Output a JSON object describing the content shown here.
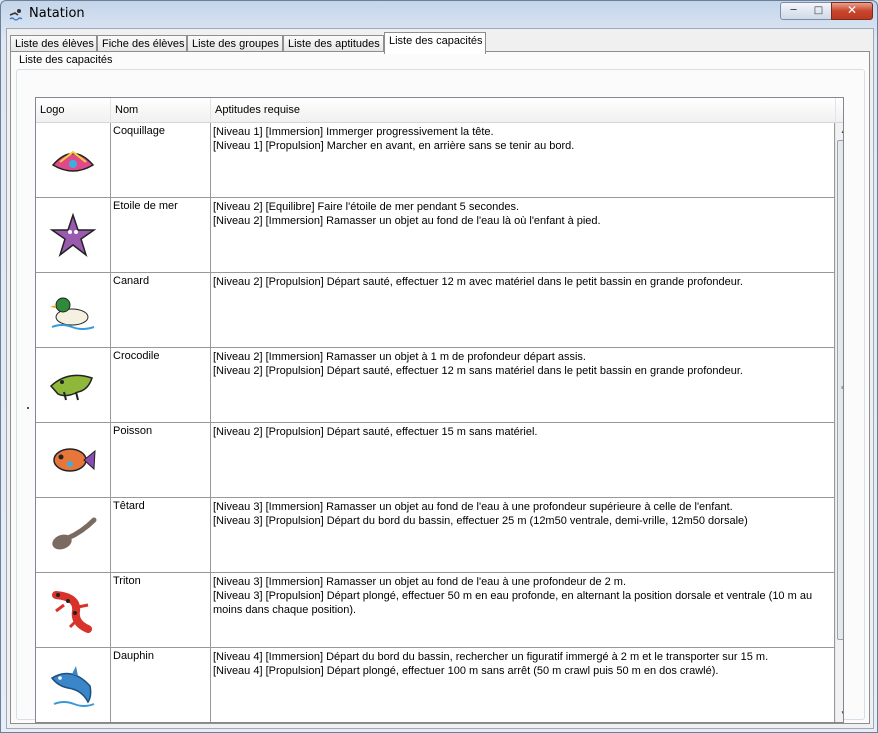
{
  "window": {
    "title": "Natation",
    "minimize": "─",
    "maximize": "□",
    "close": "✕"
  },
  "tabs": [
    {
      "label": "Liste des élèves",
      "active": false
    },
    {
      "label": "Fiche des élèves",
      "active": false
    },
    {
      "label": "Liste des groupes",
      "active": false
    },
    {
      "label": "Liste des aptitudes",
      "active": false
    },
    {
      "label": "Liste des capacités",
      "active": true
    }
  ],
  "group": {
    "label": "Liste des capacités"
  },
  "table": {
    "columns": {
      "logo": "Logo",
      "nom": "Nom",
      "aptitudes": "Aptitudes requise"
    },
    "rows": [
      {
        "nom": "Coquillage",
        "icon": "shell-icon",
        "color": "#e04a8a",
        "aptitudes": [
          "[Niveau 1] [Immersion] Immerger progressivement la tête.",
          "[Niveau 1] [Propulsion] Marcher en avant, en arrière sans se tenir au bord."
        ]
      },
      {
        "nom": "Etoile de mer",
        "icon": "starfish-icon",
        "color": "#9a5ab0",
        "aptitudes": [
          "[Niveau 2] [Equilibre] Faire l'étoile de mer pendant 5 secondes.",
          "[Niveau 2] [Immersion] Ramasser un objet au fond de l'eau là où l'enfant à pied."
        ]
      },
      {
        "nom": "Canard",
        "icon": "duck-icon",
        "color": "#2e8b3a",
        "aptitudes": [
          "[Niveau 2] [Propulsion] Départ sauté, effectuer 12 m avec matériel dans le petit bassin en grande profondeur."
        ]
      },
      {
        "nom": "Crocodile",
        "icon": "crocodile-icon",
        "color": "#8fb83a",
        "aptitudes": [
          "[Niveau 2] [Immersion] Ramasser un objet à 1 m de profondeur départ assis.",
          "[Niveau 2] [Propulsion] Départ sauté, effectuer 12 m sans matériel dans le petit bassin en grande profondeur."
        ]
      },
      {
        "nom": "Poisson",
        "icon": "fish-icon",
        "color": "#e8763a",
        "aptitudes": [
          "[Niveau 2] [Propulsion] Départ sauté, effectuer 15 m sans matériel."
        ]
      },
      {
        "nom": "Têtard",
        "icon": "tadpole-icon",
        "color": "#7a6a60",
        "aptitudes": [
          "[Niveau 3] [Immersion] Ramasser un objet au fond de l'eau à une profondeur supérieure à celle de l'enfant.",
          "[Niveau 3] [Propulsion] Départ du bord du bassin, effectuer 25 m (12m50 ventrale, demi-vrille, 12m50 dorsale)"
        ]
      },
      {
        "nom": "Triton",
        "icon": "newt-icon",
        "color": "#d8322a",
        "aptitudes": [
          "[Niveau 3] [Immersion] Ramasser un objet au fond de l'eau à une profondeur de 2 m.",
          "[Niveau 3] [Propulsion] Départ plongé, effectuer 50 m en eau profonde, en alternant la position dorsale et ventrale (10 m au moins dans chaque position)."
        ]
      },
      {
        "nom": "Dauphin",
        "icon": "dolphin-icon",
        "color": "#3a86c8",
        "aptitudes": [
          "[Niveau 4] [Immersion] Départ du bord du bassin, rechercher un figuratif immergé à 2 m et le transporter sur 15 m.",
          "[Niveau 4] [Propulsion] Départ plongé, effectuer 100 m sans arrêt (50 m crawl puis 50 m en dos crawlé)."
        ]
      }
    ]
  }
}
